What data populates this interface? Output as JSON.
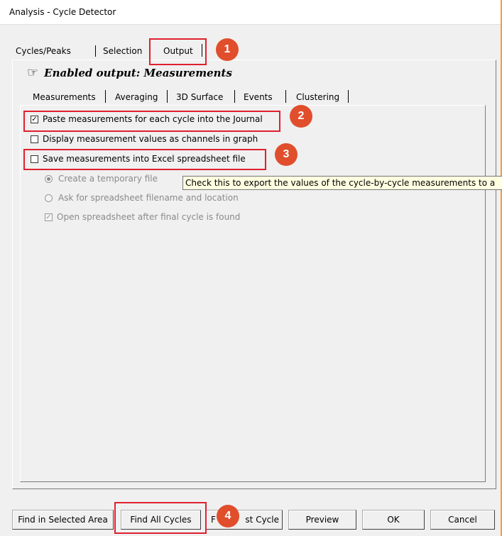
{
  "window": {
    "title": "Analysis - Cycle Detector"
  },
  "top_tabs": [
    "Cycles/Peaks",
    "Selection",
    "Output"
  ],
  "enabled_output": "Enabled output: Measurements",
  "sub_tabs": [
    "Measurements",
    "Averaging",
    "3D Surface",
    "Events",
    "Clustering"
  ],
  "options": {
    "paste": {
      "label": "Paste measurements for each cycle into the Journal",
      "checked": true
    },
    "display": {
      "label": "Display measurement values as channels in graph",
      "checked": false
    },
    "save": {
      "label": "Save measurements into Excel spreadsheet file",
      "checked": false
    },
    "temp_file": {
      "label": "Create a temporary file",
      "selected": true
    },
    "ask_file": {
      "label": "Ask for spreadsheet filename and location",
      "selected": false
    },
    "open_sheet": {
      "label": "Open spreadsheet after final cycle is found",
      "checked": true
    }
  },
  "tooltip": "Check this to export the values of the cycle-by-cycle measurements to a",
  "buttons": {
    "find_selected": "Find in Selected Area",
    "find_all": "Find All Cycles",
    "find_first": "Find First Cycle",
    "find_first_visible_start": "F",
    "find_first_visible_end": "st Cycle",
    "preview": "Preview",
    "ok": "OK",
    "cancel": "Cancel"
  },
  "badges": [
    "1",
    "2",
    "3",
    "4"
  ],
  "colors": {
    "highlight_box": "#e0202e",
    "badge": "#e04e2c",
    "tooltip_bg": "#ffffe1"
  }
}
